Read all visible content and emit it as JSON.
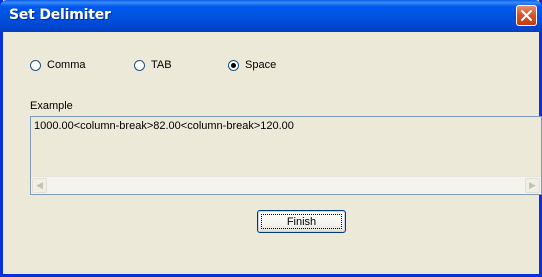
{
  "window": {
    "title": "Set Delimiter"
  },
  "delimiter_options": [
    {
      "label": "Comma",
      "checked": false
    },
    {
      "label": "TAB",
      "checked": false
    },
    {
      "label": "Space",
      "checked": true
    }
  ],
  "example": {
    "label": "Example",
    "text": "1000.00<column-break>82.00<column-break>120.00"
  },
  "finish_label": "Finish",
  "colors": {
    "titlebar": "#0152e0",
    "face": "#ece9d8",
    "close": "#d9542d"
  },
  "icons": {
    "close": "close-icon",
    "scroll_left": "scroll-left-arrow",
    "scroll_right": "scroll-right-arrow"
  }
}
